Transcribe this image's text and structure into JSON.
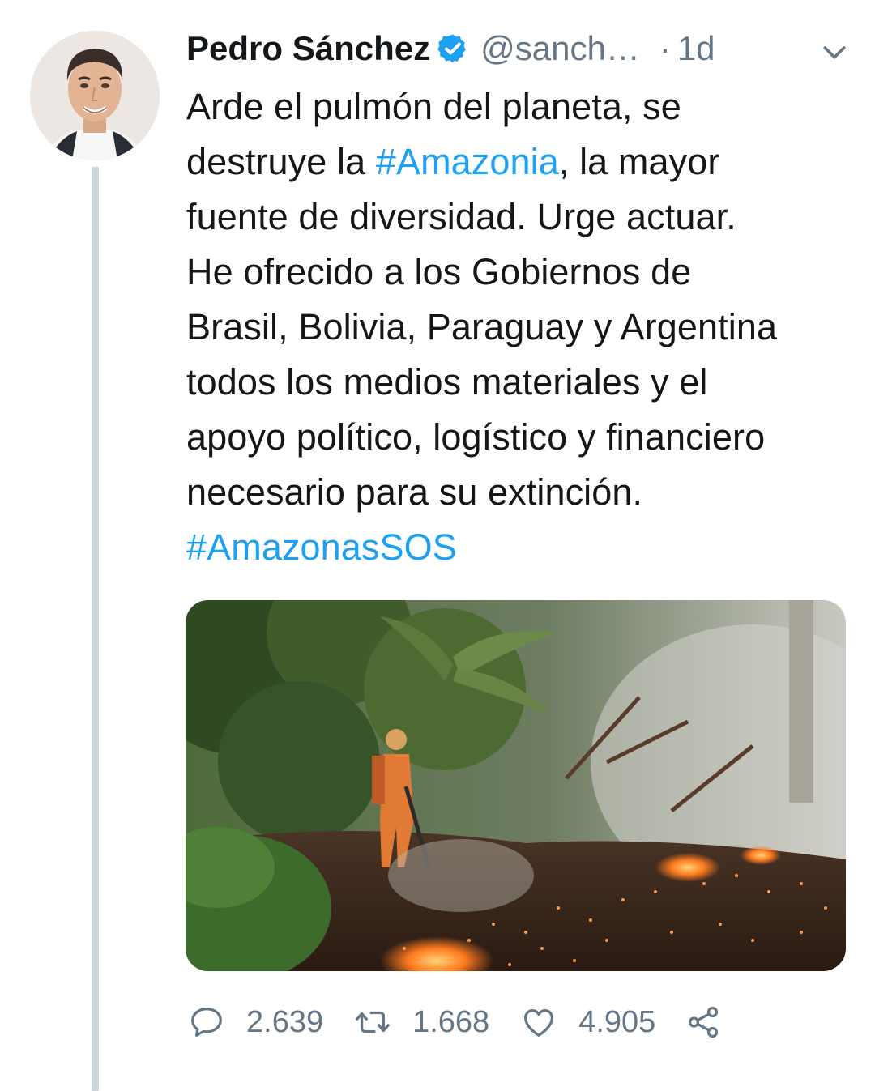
{
  "tweet": {
    "author_name": "Pedro Sánchez",
    "handle": "@sanch…",
    "separator": "·",
    "time": "1d",
    "text_lines": [
      [
        "Arde el pulmón del planeta, se"
      ],
      [
        "destruye la ",
        "#Amazonia",
        ", la mayor"
      ],
      [
        "fuente de diversidad. Urge actuar."
      ],
      [
        "He ofrecido a los Gobiernos de"
      ],
      [
        "Brasil, Bolivia, Paraguay y Argentina"
      ],
      [
        "todos los medios materiales y el"
      ],
      [
        "apoyo político, logístico y financiero"
      ],
      [
        "necesario para su extinción."
      ],
      [
        "#AmazonasSOS"
      ]
    ],
    "line_1": "Arde el pulmón del planeta, se",
    "line_2a": "destruye la ",
    "hashtag_1": "#Amazonia",
    "line_2b": ", la mayor",
    "line_3": "fuente de diversidad. Urge actuar.",
    "line_4": "He ofrecido a los Gobiernos de",
    "line_5": "Brasil, Bolivia, Paraguay y Argentina",
    "line_6": "todos los medios materiales y el",
    "line_7": "apoyo político, logístico y financiero",
    "line_8": "necesario para su extinción.",
    "hashtag_2": "#AmazonasSOS"
  },
  "actions": {
    "replies": "2.639",
    "retweets": "1.668",
    "likes": "4.905"
  },
  "icons": {
    "verified": "verified-badge-icon",
    "menu": "chevron-down-icon",
    "reply": "reply-bubble-icon",
    "retweet": "retweet-icon",
    "like": "heart-icon",
    "share": "share-icon"
  },
  "colors": {
    "link": "#1da1f2",
    "muted": "#657786",
    "text": "#14171a",
    "thread_line": "#ccd6dd"
  }
}
